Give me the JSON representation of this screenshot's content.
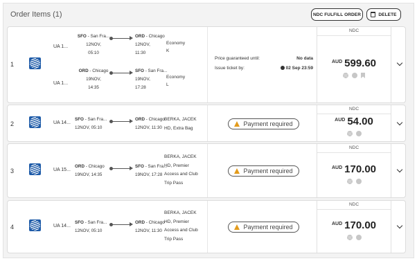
{
  "header": {
    "title": "Order Items (1)",
    "fulfill_label": "NDC FULFILL ORDER",
    "delete_label": "DELETE"
  },
  "rows": [
    {
      "number": "1",
      "legs": [
        {
          "flight": "UA 1...",
          "from_code": "SFO",
          "from_city": " - San Fra...",
          "dep_date": "12NOV,",
          "dep_time": "05:10",
          "to_code": "ORD",
          "to_city": " - Chicago",
          "arr_date": "12NOV,",
          "arr_time": "11:30",
          "cabin": "Economy",
          "fare": "K"
        },
        {
          "flight": "UA 1...",
          "from_code": "ORD",
          "from_city": " - Chicago",
          "dep_date": "19NOV,",
          "dep_time": "14:35",
          "to_code": "SFO",
          "to_city": " - San Fra...",
          "arr_date": "19NOV,",
          "arr_time": "17:28",
          "cabin": "Economy",
          "fare": "L"
        }
      ],
      "price_guaranteed_label": "Price guaranteed until:",
      "price_guaranteed_value": "No data",
      "issue_label": "Issue ticket by:",
      "issue_value": "02 Sep 23:59",
      "tag": "NDC",
      "currency": "AUD",
      "amount": "599.60"
    },
    {
      "number": "2",
      "flight": "UA 14...",
      "from_code": "SFO",
      "from_city": " - San Fra...",
      "dep": "12NOV, 05:10",
      "to_code": "ORD",
      "to_city": " - Chicago",
      "arr": "12NOV, 11:30",
      "pax_lines": [
        "BERKA, JACEK",
        "HD, Extra Bag"
      ],
      "status": "Payment required",
      "tag": "NDC",
      "currency": "AUD",
      "amount": "54.00"
    },
    {
      "number": "3",
      "flight": "UA 15...",
      "from_code": "ORD",
      "from_city": " - Chicago",
      "dep": "19NOV, 14:35",
      "to_code": "SFO",
      "to_city": " - San Fra...",
      "arr": "19NOV, 17:28",
      "pax_lines": [
        "BERKA, JACEK",
        "HD, Premier",
        "Access and Club",
        "Trip Pass"
      ],
      "status": "Payment required",
      "tag": "NDC",
      "currency": "AUD",
      "amount": "170.00"
    },
    {
      "number": "4",
      "flight": "UA 14...",
      "from_code": "SFO",
      "from_city": " - San Fra...",
      "dep": "12NOV, 05:10",
      "to_code": "ORD",
      "to_city": " - Chicago",
      "arr": "12NOV, 11:30",
      "pax_lines": [
        "BERKA, JACEK",
        "HD, Premier",
        "Access and Club",
        "Trip Pass"
      ],
      "status": "Payment required",
      "tag": "NDC",
      "currency": "AUD",
      "amount": "170.00"
    }
  ],
  "colors": {
    "airline_logo": "#1e5ba8",
    "warning": "#e39b1c"
  },
  "icons": [
    "airline-logo-icon",
    "trash-icon",
    "clock-icon",
    "warning-icon",
    "gear-icon",
    "circle-icon",
    "bookmark-icon",
    "chevron-down-icon"
  ]
}
